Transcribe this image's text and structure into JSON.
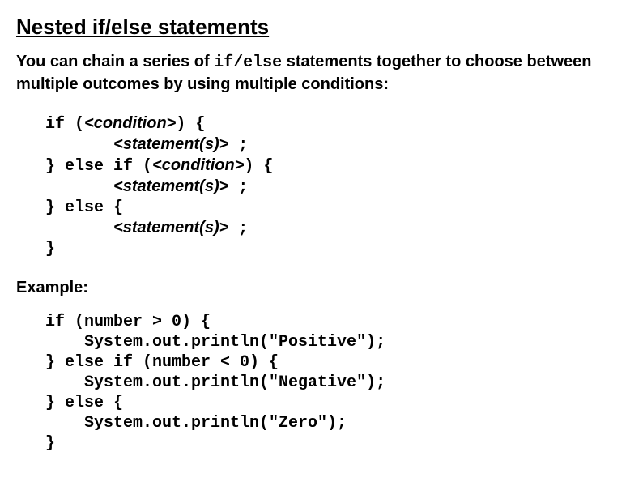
{
  "title": "Nested if/else statements",
  "intro_pre": "You can chain a series of ",
  "intro_mono": "if/else",
  "intro_post": " statements together to choose between multiple outcomes by using multiple conditions:",
  "syntax": {
    "l1_a": "if (",
    "l1_i": "<condition>",
    "l1_b": ") {",
    "l2_pad": "       ",
    "l2_i": "<statement(s)>",
    "l2_b": " ;",
    "l3_a": "} else if (",
    "l3_i": "<condition>",
    "l3_b": ") {",
    "l4_pad": "       ",
    "l4_i": "<statement(s)>",
    "l4_b": " ;",
    "l5_a": "} else {",
    "l6_pad": "       ",
    "l6_i": "<statement(s)>",
    "l6_b": " ;",
    "l7_a": "}"
  },
  "example_label": "Example:",
  "example": {
    "l1": "if (number > 0) {",
    "l2": "    System.out.println(\"Positive\");",
    "l3": "} else if (number < 0) {",
    "l4": "    System.out.println(\"Negative\");",
    "l5": "} else {",
    "l6": "    System.out.println(\"Zero\");",
    "l7": "}"
  }
}
